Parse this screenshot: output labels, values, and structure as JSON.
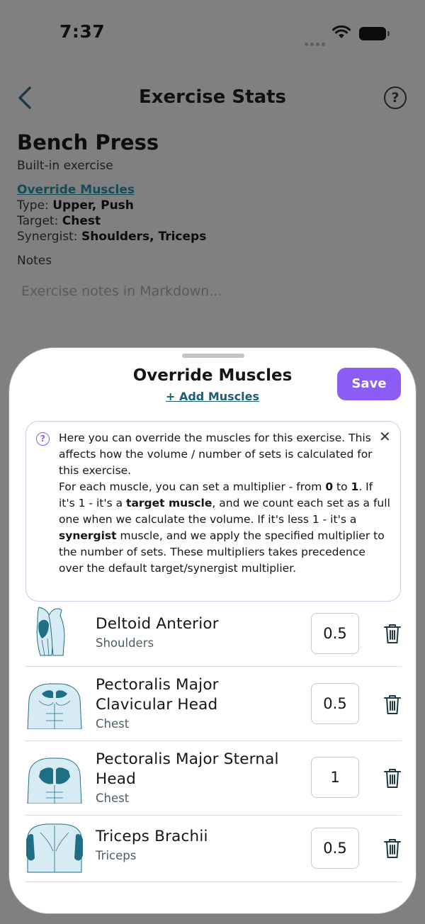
{
  "status_bar": {
    "time": "7:37",
    "icons": [
      "signal-dots-icon",
      "wifi-icon",
      "battery-icon"
    ]
  },
  "nav": {
    "title": "Exercise Stats",
    "back_icon": "chevron-left-icon",
    "help_icon": "?"
  },
  "exercise": {
    "name": "Bench Press",
    "kind": "Built-in exercise",
    "override_link": "Override Muscles",
    "type_label": "Type: ",
    "type_value": "Upper, Push",
    "target_label": "Target: ",
    "target_value": "Chest",
    "synergist_label": "Synergist: ",
    "synergist_value": "Shoulders, Triceps",
    "notes_label": "Notes",
    "notes_placeholder": "Exercise notes in Markdown..."
  },
  "sheet": {
    "title": "Override Muscles",
    "add_label": "+ Add Muscles",
    "save_label": "Save",
    "info": {
      "icon": "?",
      "close": "✕",
      "line1": "Here you can override the muscles for this exercise. This affects how the volume / number of sets is calculated for this exercise.",
      "line2_a": "For each muscle, you can set a multiplier - from ",
      "line2_b": "0",
      "line2_c": " to ",
      "line2_d": "1",
      "line2_e": ". If it's 1 - it's a ",
      "line2_f": "target muscle",
      "line2_g": ", and we count each set as a full one when we calculate the volume. If it's less 1 - it's a ",
      "line2_h": "synergist",
      "line2_i": " muscle, and we apply the specified multiplier to the number of sets. These multipliers takes precedence over the default target/synergist multiplier."
    },
    "muscles": [
      {
        "name": "Deltoid Anterior",
        "group": "Shoulders",
        "multiplier": "0.5"
      },
      {
        "name": "Pectoralis Major Clavicular Head",
        "group": "Chest",
        "multiplier": "0.5"
      },
      {
        "name": "Pectoralis Major Sternal Head",
        "group": "Chest",
        "multiplier": "1"
      },
      {
        "name": "Triceps Brachii",
        "group": "Triceps",
        "multiplier": "0.5"
      }
    ]
  },
  "colors": {
    "accent": "#8b5cf6",
    "link": "#1d5f70",
    "muscle_highlight": "#1e6e86",
    "muscle_body": "#c7e2ef"
  }
}
